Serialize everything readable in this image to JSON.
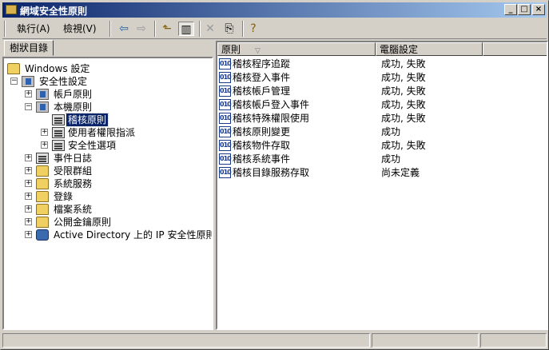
{
  "window": {
    "title": "網域安全性原則"
  },
  "menu": {
    "action": "執行(A)",
    "view": "檢視(V)"
  },
  "tree": {
    "tab_label": "樹狀目錄",
    "items": [
      {
        "label": "Windows 設定"
      },
      {
        "label": "安全性設定"
      },
      {
        "label": "帳戶原則"
      },
      {
        "label": "本機原則"
      },
      {
        "label": "稽核原則"
      },
      {
        "label": "使用者權限指派"
      },
      {
        "label": "安全性選項"
      },
      {
        "label": "事件日誌"
      },
      {
        "label": "受限群組"
      },
      {
        "label": "系統服務"
      },
      {
        "label": "登錄"
      },
      {
        "label": "檔案系統"
      },
      {
        "label": "公開金鑰原則"
      },
      {
        "label": "Active Directory 上的 IP 安全性原則"
      }
    ]
  },
  "list": {
    "columns": {
      "policy": "原則",
      "setting": "電腦設定"
    },
    "rows": [
      {
        "policy": "稽核程序追蹤",
        "setting": "成功, 失敗"
      },
      {
        "policy": "稽核登入事件",
        "setting": "成功, 失敗"
      },
      {
        "policy": "稽核帳戶管理",
        "setting": "成功, 失敗"
      },
      {
        "policy": "稽核帳戶登入事件",
        "setting": "成功, 失敗"
      },
      {
        "policy": "稽核特殊權限使用",
        "setting": "成功, 失敗"
      },
      {
        "policy": "稽核原則變更",
        "setting": "成功"
      },
      {
        "policy": "稽核物件存取",
        "setting": "成功, 失敗"
      },
      {
        "policy": "稽核系統事件",
        "setting": "成功"
      },
      {
        "policy": "稽核目錄服務存取",
        "setting": "尚未定義"
      }
    ]
  },
  "icons": {
    "back": "back-arrow-icon",
    "forward": "forward-arrow-icon",
    "up": "up-folder-icon",
    "show_hide_tree": "show-hide-tree-icon",
    "delete": "delete-icon",
    "export": "export-list-icon",
    "help": "help-icon"
  },
  "colors": {
    "title_start": "#0a246a",
    "title_end": "#a6caf0",
    "selection": "#0a246a",
    "face": "#d4d0c8"
  }
}
